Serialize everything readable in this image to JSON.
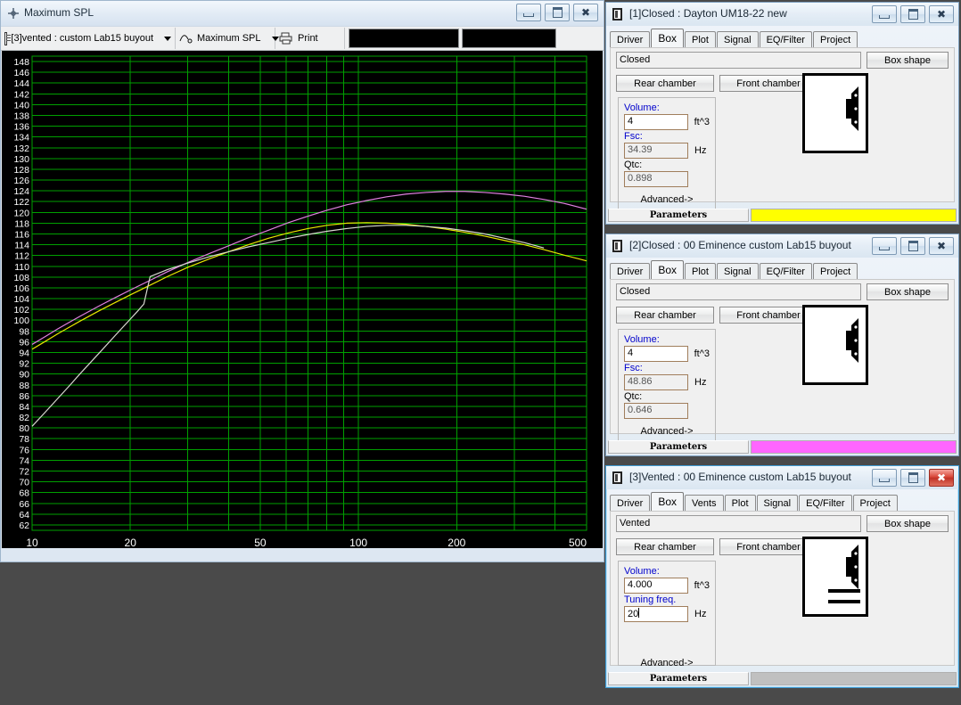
{
  "spl_window": {
    "title": "Maximum SPL",
    "icon": "crosshair-icon",
    "minimize_label": "Minimize",
    "maximize_label": "Maximize",
    "close_label": "Close",
    "toolbar": {
      "project_combo": {
        "value": "[3]vented : custom Lab15 buyout",
        "icon": "document-icon"
      },
      "plot_combo": {
        "value": "Maximum SPL",
        "icon": "curve-icon"
      },
      "print_button": {
        "label": "Print",
        "icon": "printer-icon"
      }
    }
  },
  "chart_data": {
    "type": "line",
    "title": "Maximum SPL",
    "xlabel": "",
    "ylabel": "",
    "xscale": "log",
    "xlim": [
      10,
      500
    ],
    "ylim": [
      61,
      149
    ],
    "xticks": [
      10,
      20,
      50,
      100,
      200,
      500
    ],
    "xtick_labels": [
      "10",
      "20",
      "50",
      "100",
      "200",
      "500"
    ],
    "yticks": [
      148,
      146,
      144,
      142,
      140,
      138,
      136,
      134,
      132,
      130,
      128,
      126,
      124,
      122,
      120,
      118,
      116,
      114,
      112,
      110,
      108,
      106,
      104,
      102,
      100,
      98,
      96,
      94,
      92,
      90,
      88,
      86,
      84,
      82,
      80,
      78,
      76,
      74,
      72,
      70,
      68,
      66,
      64,
      62
    ],
    "grid": true,
    "grid_color": "#00a000",
    "background": "#000000",
    "legend": "none",
    "series": [
      {
        "name": "[1]Closed : Dayton UM18-22 new",
        "color": "#e080e0",
        "x": [
          10,
          11,
          12,
          13,
          14,
          16,
          18,
          20,
          23,
          26,
          30,
          35,
          40,
          46,
          53,
          61,
          70,
          80,
          92,
          106,
          122,
          140,
          161,
          185,
          212,
          244,
          280,
          322,
          370,
          425,
          500
        ],
        "values": [
          95.5,
          97.0,
          98.4,
          99.6,
          100.7,
          102.6,
          104.2,
          105.6,
          107.4,
          109.0,
          110.7,
          112.4,
          113.8,
          115.3,
          116.7,
          118.1,
          119.3,
          120.4,
          121.4,
          122.2,
          122.9,
          123.4,
          123.7,
          123.9,
          123.9,
          123.7,
          123.4,
          123.0,
          122.4,
          121.7,
          120.6
        ]
      },
      {
        "name": "[2]Closed : 00 Eminence custom Lab15 buyout",
        "color": "#e8e800",
        "x": [
          10,
          11,
          12,
          13,
          14,
          16,
          18,
          20,
          23,
          26,
          30,
          35,
          40,
          46,
          53,
          61,
          70,
          80,
          92,
          106,
          122,
          140,
          161,
          185,
          212,
          244,
          280,
          322,
          370,
          425,
          500
        ],
        "values": [
          94.6,
          96.1,
          97.5,
          98.7,
          99.8,
          101.7,
          103.3,
          104.7,
          106.5,
          108.1,
          109.8,
          111.4,
          112.7,
          114.0,
          115.2,
          116.2,
          117.0,
          117.6,
          118.0,
          118.1,
          118.0,
          117.8,
          117.4,
          116.9,
          116.3,
          115.6,
          114.8,
          114.0,
          113.1,
          112.1,
          111.0
        ]
      },
      {
        "name": "[3]Vented : 00 Eminence custom Lab15 buyout",
        "color": "#d8d8d0",
        "x": [
          10,
          11,
          12,
          13,
          14,
          16,
          18,
          20,
          21,
          22,
          23,
          26,
          30,
          35,
          40,
          46,
          53,
          61,
          70,
          80,
          92,
          106,
          122,
          140,
          161,
          185,
          212,
          244,
          280,
          322,
          370,
          425,
          500
        ],
        "values": [
          80.3,
          83.0,
          85.5,
          87.8,
          90.0,
          93.8,
          97.2,
          100.2,
          101.6,
          103.0,
          108.1,
          109.4,
          110.6,
          111.8,
          112.7,
          113.6,
          114.4,
          115.2,
          115.9,
          116.5,
          117.0,
          117.4,
          117.6,
          117.6,
          117.4,
          117.1,
          116.6,
          116.0,
          115.2,
          114.4,
          113.4
        ]
      }
    ]
  },
  "windows": [
    {
      "id": "window-1",
      "title": "[1]Closed : Dayton UM18-22 new",
      "tabs": [
        "Driver",
        "Box",
        "Plot",
        "Signal",
        "EQ/Filter",
        "Project"
      ],
      "selected_tab": "Box",
      "box_type": "Closed",
      "box_shape_label": "Box shape",
      "rear_chamber_label": "Rear chamber",
      "front_chamber_label": "Front chamber",
      "fields": [
        {
          "label": "Volume:",
          "value": "4",
          "unit": "ft^3",
          "readonly": false
        },
        {
          "label": "Fsc:",
          "value": "34.39",
          "unit": "Hz",
          "readonly": true
        },
        {
          "label": "Qtc:",
          "value": "0.898",
          "unit": "",
          "readonly": true
        }
      ],
      "advanced_label": "Advanced->",
      "status_label": "Parameters",
      "status_color": "#ffff00",
      "active": false,
      "shape": "closed"
    },
    {
      "id": "window-2",
      "title": "[2]Closed : 00 Eminence custom Lab15 buyout",
      "tabs": [
        "Driver",
        "Box",
        "Plot",
        "Signal",
        "EQ/Filter",
        "Project"
      ],
      "selected_tab": "Box",
      "box_type": "Closed",
      "box_shape_label": "Box shape",
      "rear_chamber_label": "Rear chamber",
      "front_chamber_label": "Front chamber",
      "fields": [
        {
          "label": "Volume:",
          "value": "4",
          "unit": "ft^3",
          "readonly": false
        },
        {
          "label": "Fsc:",
          "value": "48.86",
          "unit": "Hz",
          "readonly": true
        },
        {
          "label": "Qtc:",
          "value": "0.646",
          "unit": "",
          "readonly": true
        }
      ],
      "advanced_label": "Advanced->",
      "status_label": "Parameters",
      "status_color": "#ff66ff",
      "active": false,
      "shape": "closed"
    },
    {
      "id": "window-3",
      "title": "[3]Vented : 00 Eminence custom Lab15 buyout",
      "tabs": [
        "Driver",
        "Box",
        "Vents",
        "Plot",
        "Signal",
        "EQ/Filter",
        "Project"
      ],
      "selected_tab": "Box",
      "box_type": "Vented",
      "box_shape_label": "Box shape",
      "rear_chamber_label": "Rear chamber",
      "front_chamber_label": "Front chamber",
      "fields": [
        {
          "label": "Volume:",
          "value": "4.000",
          "unit": "ft^3",
          "readonly": false
        },
        {
          "label": "Tuning freq.",
          "value": "20",
          "unit": "Hz",
          "readonly": false
        }
      ],
      "advanced_label": "Advanced->",
      "status_label": "Parameters",
      "status_color": "#c0c0c0",
      "active": true,
      "shape": "vented"
    }
  ]
}
